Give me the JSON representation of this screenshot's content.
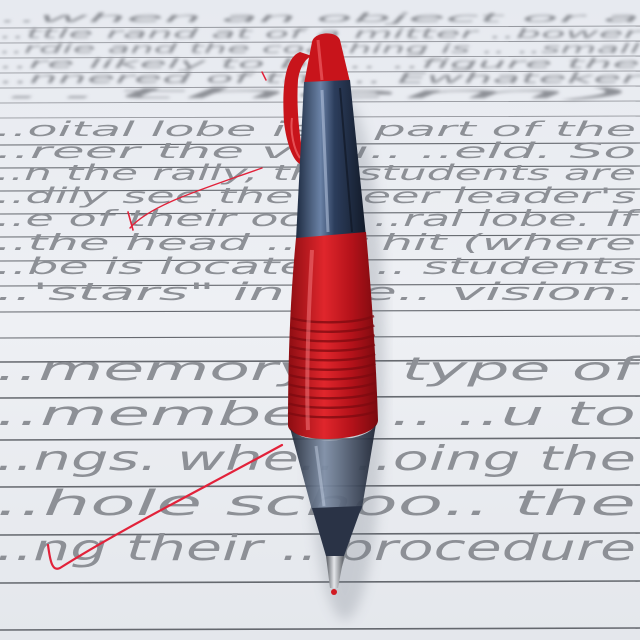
{
  "photo": {
    "subject": "pen-on-lined-notebook-paper",
    "colors": {
      "paper": "#eef0f4",
      "rule_line": "#3a3d44",
      "handwriting": "#8d9096",
      "pen_red": "#c8141b",
      "pen_barrel": "#2b3a55",
      "ink_red": "#e2223a"
    },
    "handwriting_lines": [
      "..when an object or a",
      "..ttle rand at of a mitter ..bower",
      "..rdie and the coaching is .. ..small",
      "..re likely to be .. ..figure the",
      "..nnered of the .. Ewhateker",
      "..them)",
      "..oital lobe is .. part of the",
      "..reer the visu.. ..eld. So",
      "..n the rally, the students are",
      "..dily see the cheer leader's",
      "..e of their occ.. ..ral lobe. If",
      "..the head .. ..r hit (where",
      "..be is located) .. students",
      "..'stars\" in the.. vision.",
      "..memory .. type of",
      "..members .. ..u to",
      "..ngs. whe.. ..oing the",
      "..hole schoo.. the",
      "..ng their .. procedure"
    ]
  }
}
